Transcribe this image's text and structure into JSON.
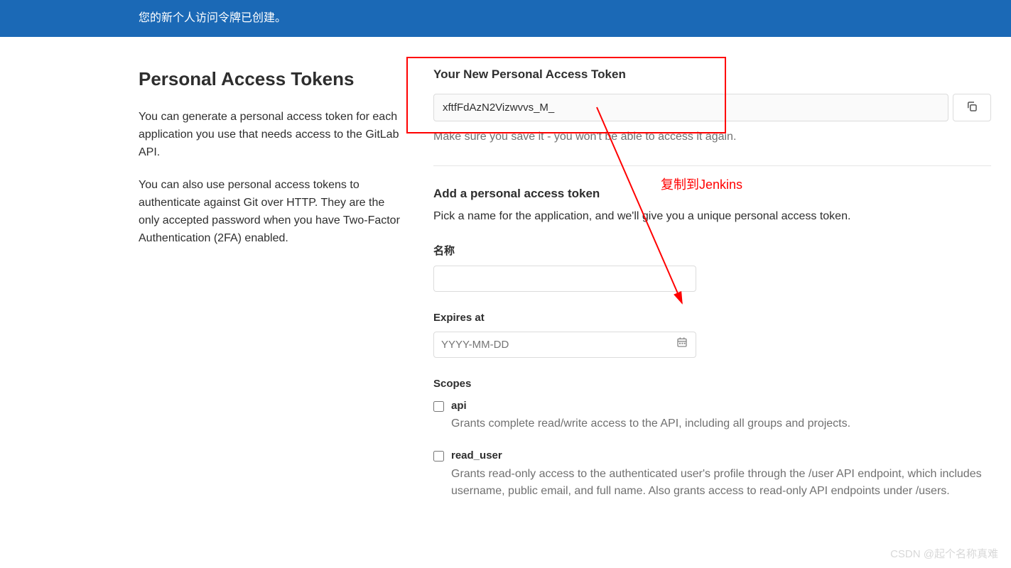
{
  "banner": {
    "text": "您的新个人访问令牌已创建。"
  },
  "sidebar": {
    "title": "Personal Access Tokens",
    "para1": "You can generate a personal access token for each application you use that needs access to the GitLab API.",
    "para2": "You can also use personal access tokens to authenticate against Git over HTTP. They are the only accepted password when you have Two-Factor Authentication (2FA) enabled."
  },
  "token": {
    "heading": "Your New Personal Access Token",
    "value": "xftfFdAzN2Vizwvvs_M_",
    "warning": "Make sure you save it - you won't be able to access it again."
  },
  "add": {
    "heading": "Add a personal access token",
    "desc": "Pick a name for the application, and we'll give you a unique personal access token."
  },
  "fields": {
    "name_label": "名称",
    "expires_label": "Expires at",
    "expires_placeholder": "YYYY-MM-DD",
    "scopes_label": "Scopes"
  },
  "scopes": [
    {
      "name": "api",
      "desc": "Grants complete read/write access to the API, including all groups and projects."
    },
    {
      "name": "read_user",
      "desc": "Grants read-only access to the authenticated user's profile through the /user API endpoint, which includes username, public email, and full name. Also grants access to read-only API endpoints under /users."
    }
  ],
  "annotation": {
    "text": "复制到Jenkins"
  },
  "watermark": "CSDN @起个名称真难"
}
